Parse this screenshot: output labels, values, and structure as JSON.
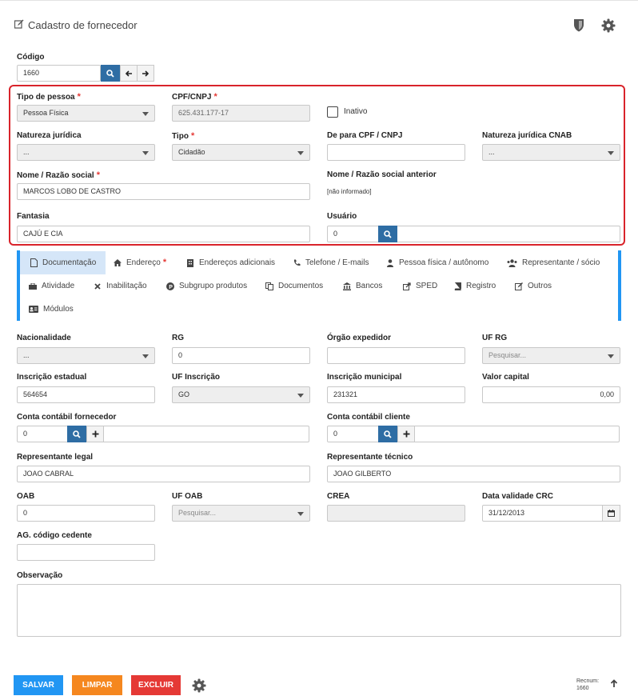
{
  "page": {
    "title": "Cadastro de fornecedor"
  },
  "codigo": {
    "label": "Código",
    "value": "1660"
  },
  "main_box": {
    "tipo_pessoa": {
      "label": "Tipo de pessoa",
      "value": "Pessoa Física"
    },
    "cpf_cnpj": {
      "label": "CPF/CNPJ",
      "value": "625.431.177-17"
    },
    "inativo": {
      "label": "Inativo"
    },
    "natureza_juridica": {
      "label": "Natureza jurídica",
      "value": "..."
    },
    "tipo": {
      "label": "Tipo",
      "value": "Cidadão"
    },
    "de_para": {
      "label": "De para CPF / CNPJ",
      "value": ""
    },
    "natureza_cnab": {
      "label": "Natureza jurídica CNAB",
      "value": "..."
    },
    "nome": {
      "label": "Nome / Razão social",
      "value": "MARCOS LOBO DE CASTRO"
    },
    "nome_anterior": {
      "label": "Nome / Razão social anterior",
      "value": "[não informado]"
    },
    "fantasia": {
      "label": "Fantasia",
      "value": "CAJÚ E CIA"
    },
    "usuario": {
      "label": "Usuário",
      "value": "0"
    }
  },
  "tabs": [
    {
      "label": "Documentação",
      "icon": "file-icon"
    },
    {
      "label": "Endereço",
      "icon": "home-icon",
      "required": "*"
    },
    {
      "label": "Endereços adicionais",
      "icon": "building-icon"
    },
    {
      "label": "Telefone / E-mails",
      "icon": "phone-icon"
    },
    {
      "label": "Pessoa física / autônomo",
      "icon": "user-icon"
    },
    {
      "label": "Representante / sócio",
      "icon": "users-icon"
    },
    {
      "label": "Atividade",
      "icon": "briefcase-icon"
    },
    {
      "label": "Inabilitação",
      "icon": "times-icon"
    },
    {
      "label": "Subgrupo produtos",
      "icon": "product-hunt-icon"
    },
    {
      "label": "Documentos",
      "icon": "copy-icon"
    },
    {
      "label": "Bancos",
      "icon": "bank-icon"
    },
    {
      "label": "SPED",
      "icon": "share-icon"
    },
    {
      "label": "Registro",
      "icon": "book-icon"
    },
    {
      "label": "Outros",
      "icon": "edit-icon"
    },
    {
      "label": "Módulos",
      "icon": "id-card-icon"
    }
  ],
  "doc": {
    "nacionalidade": {
      "label": "Nacionalidade",
      "value": "..."
    },
    "rg": {
      "label": "RG",
      "value": "0"
    },
    "orgao": {
      "label": "Órgão expedidor",
      "value": ""
    },
    "uf_rg": {
      "label": "UF RG",
      "placeholder": "Pesquisar..."
    },
    "insc_estadual": {
      "label": "Inscrição estadual",
      "value": "564654"
    },
    "uf_inscricao": {
      "label": "UF Inscrição",
      "value": "GO"
    },
    "insc_municipal": {
      "label": "Inscrição municipal",
      "value": "231321"
    },
    "valor_capital": {
      "label": "Valor capital",
      "value": "0,00"
    },
    "conta_fornecedor": {
      "label": "Conta contábil fornecedor",
      "value": "0"
    },
    "conta_cliente": {
      "label": "Conta contábil cliente",
      "value": "0"
    },
    "rep_legal": {
      "label": "Representante legal",
      "value": "JOAO CABRAL"
    },
    "rep_tecnico": {
      "label": "Representante técnico",
      "value": "JOAO GILBERTO"
    },
    "oab": {
      "label": "OAB",
      "value": "0"
    },
    "uf_oab": {
      "label": "UF OAB",
      "placeholder": "Pesquisar..."
    },
    "crea": {
      "label": "CREA",
      "value": ""
    },
    "data_crc": {
      "label": "Data validade CRC",
      "value": "31/12/2013"
    },
    "ag_cedente": {
      "label": "AG. código cedente",
      "value": ""
    },
    "observacao": {
      "label": "Observação",
      "value": ""
    }
  },
  "actions": {
    "salvar": "SALVAR",
    "limpar": "LIMPAR",
    "excluir": "EXCLUIR",
    "recnum_label": "Recnum:",
    "recnum_value": "1660"
  },
  "colors": {
    "required": "#e53935",
    "primary_blue": "#2e6da4",
    "tab_border": "#2196f3",
    "salvar": "#2196f3",
    "limpar": "#f5871f",
    "excluir": "#e53935",
    "highlight_box": "#d9242b"
  }
}
